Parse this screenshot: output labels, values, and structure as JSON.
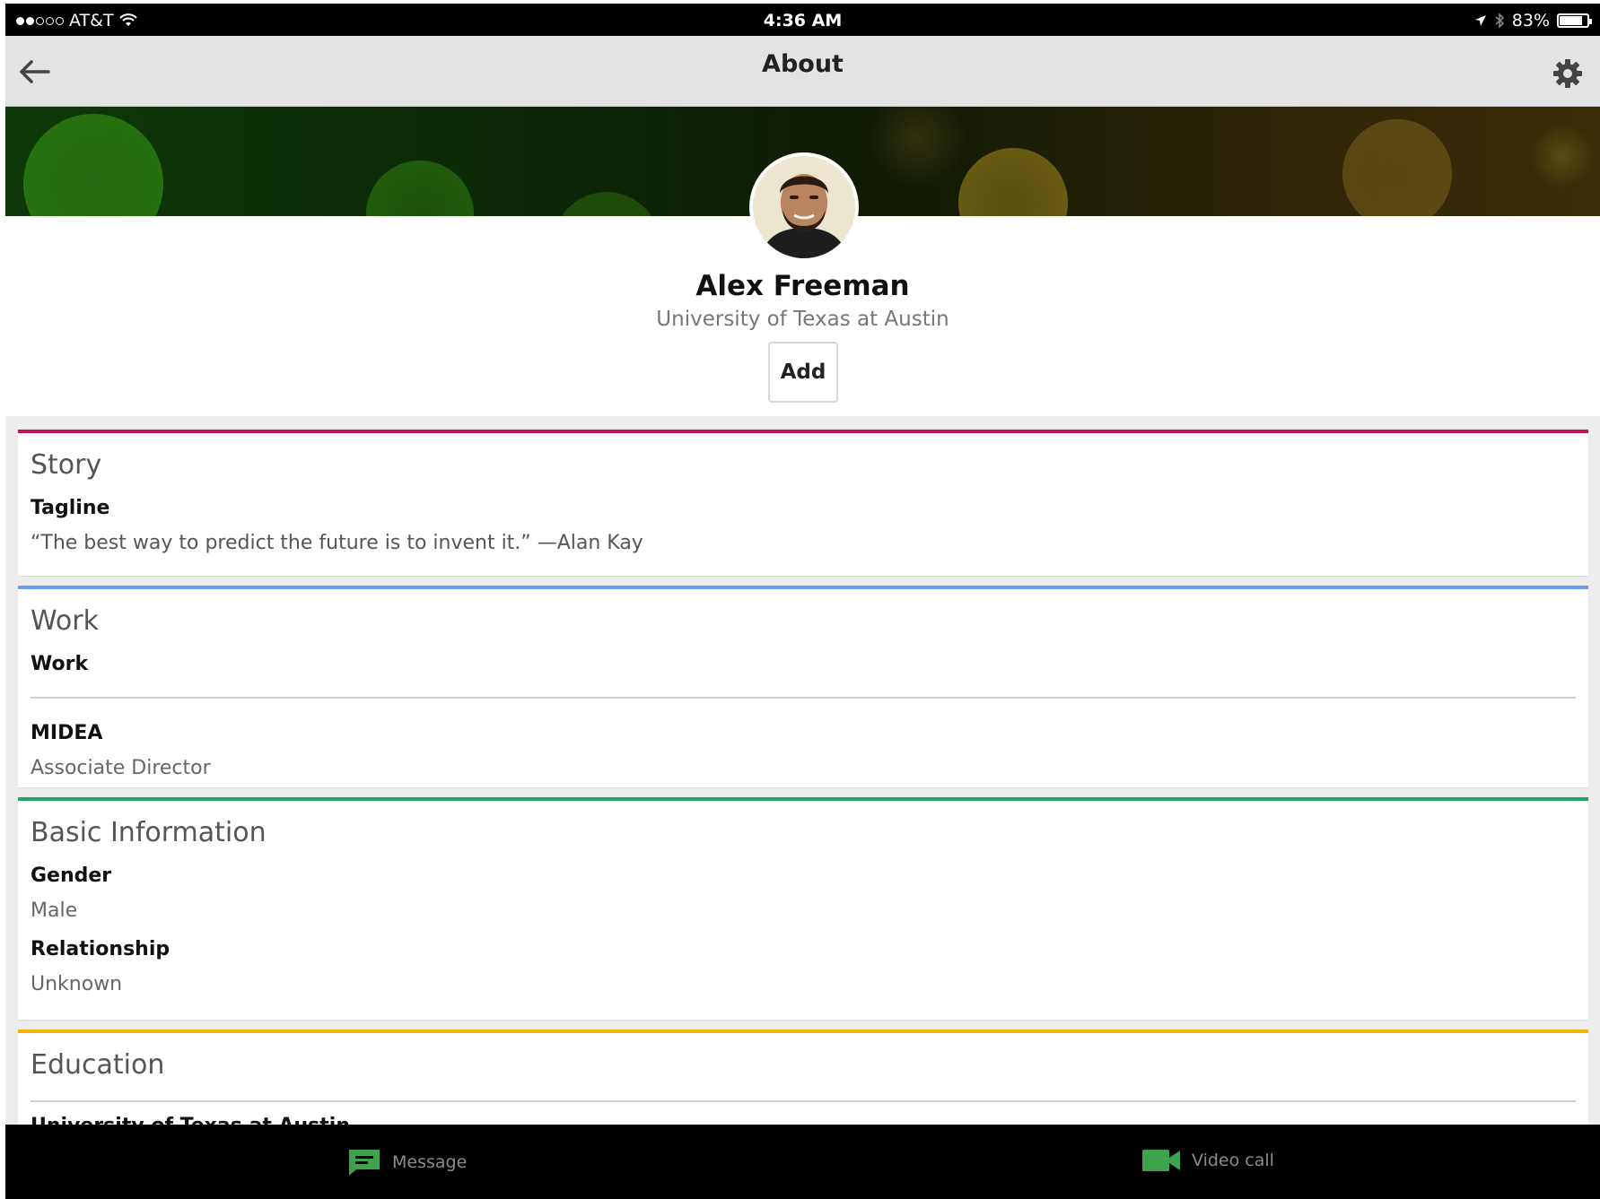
{
  "status_bar": {
    "carrier": "AT&T",
    "time": "4:36 AM",
    "battery": "83%",
    "battery_level": 0.83
  },
  "app_bar": {
    "title": "About"
  },
  "profile": {
    "name": "Alex Freeman",
    "subtitle": "University of Texas at Austin",
    "add_label": "Add"
  },
  "cards": {
    "story": {
      "title": "Story",
      "accent": "#c2185b",
      "tagline_label": "Tagline",
      "tagline_value": "“The best way to predict the future is to invent it.” —Alan Kay"
    },
    "work": {
      "title": "Work",
      "accent": "#6a9cf4",
      "work_label": "Work",
      "company": "MIDEA",
      "position": "Associate Director"
    },
    "basic": {
      "title": "Basic Information",
      "accent": "#1fa463",
      "gender_label": "Gender",
      "gender_value": "Male",
      "relationship_label": "Relationship",
      "relationship_value": "Unknown"
    },
    "education": {
      "title": "Education",
      "accent": "#f4b400",
      "school": "University of Texas at Austin"
    }
  },
  "bottom_bar": {
    "message_label": "Message",
    "video_call_label": "Video call",
    "accent": "#3fa34d"
  }
}
